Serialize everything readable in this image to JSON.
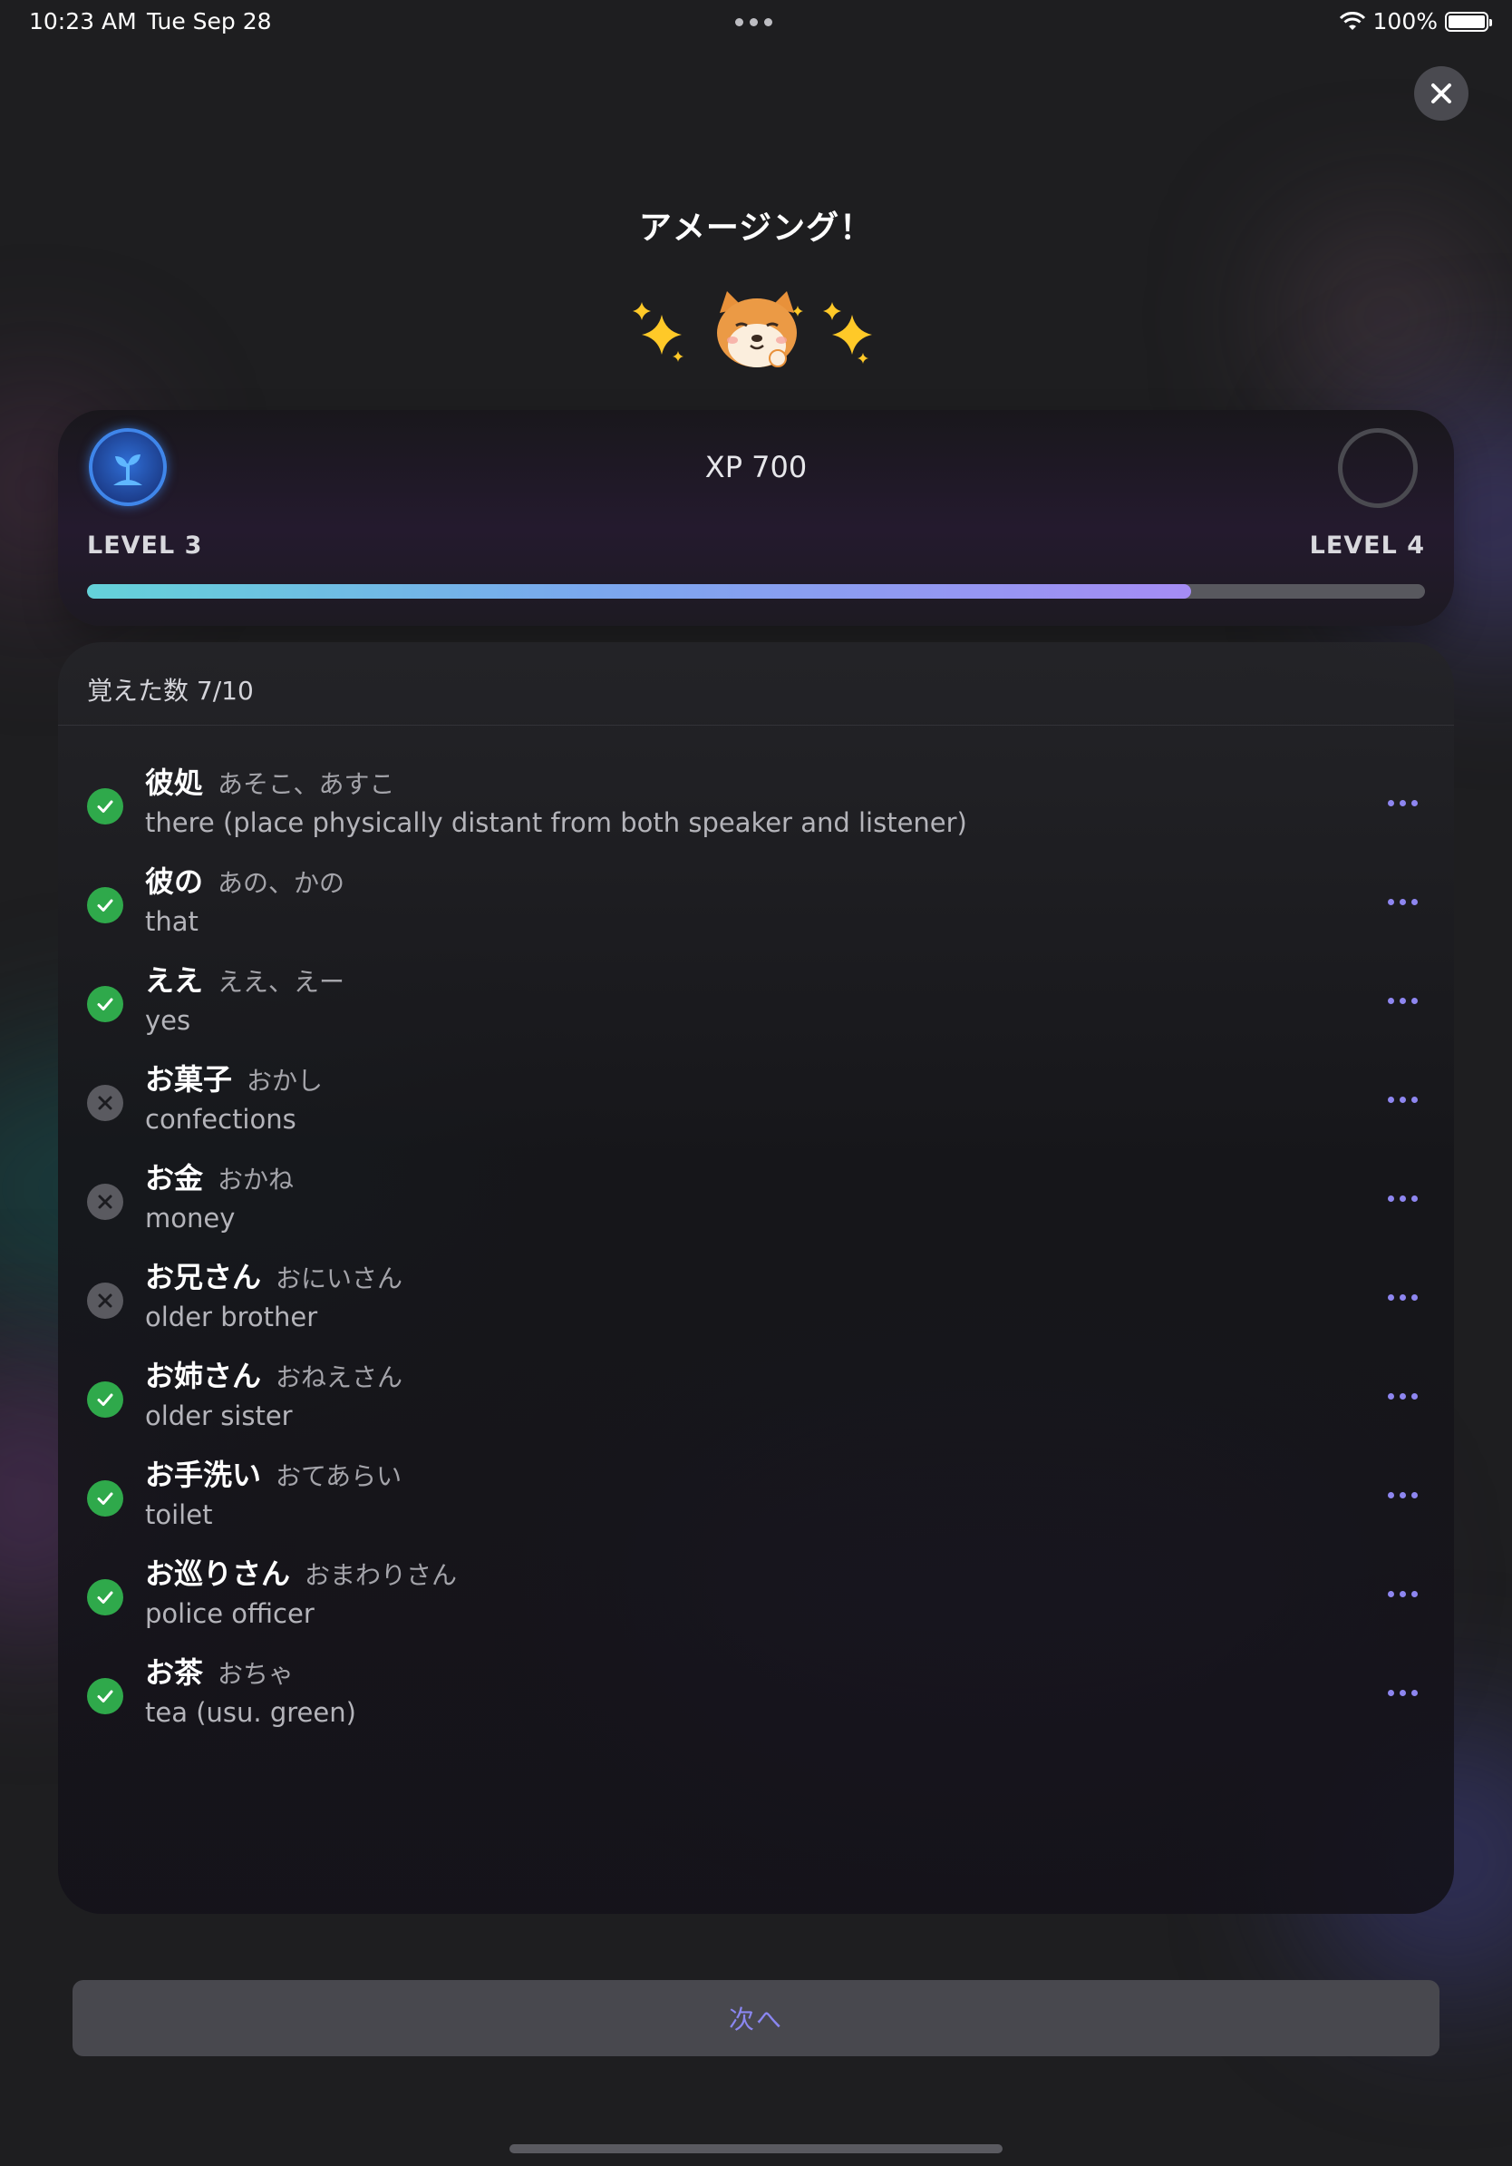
{
  "status_bar": {
    "time": "10:23 AM",
    "date": "Tue Sep 28",
    "battery": "100%"
  },
  "title": "アメージング！",
  "level": {
    "xp_label": "XP 700",
    "current_level": "LEVEL 3",
    "next_level": "LEVEL 4",
    "progress": 0.825
  },
  "words": {
    "header_label": "覚えた数",
    "header_count": "7/10",
    "items": [
      {
        "kanji": "彼処",
        "reading": "あそこ、あすこ",
        "meaning": "there (place physically distant from both speaker and listener)",
        "learned": true
      },
      {
        "kanji": "彼の",
        "reading": "あの、かの",
        "meaning": "that",
        "learned": true
      },
      {
        "kanji": "ええ",
        "reading": "ええ、えー",
        "meaning": "yes",
        "learned": true
      },
      {
        "kanji": "お菓子",
        "reading": "おかし",
        "meaning": "confections",
        "learned": false
      },
      {
        "kanji": "お金",
        "reading": "おかね",
        "meaning": "money",
        "learned": false
      },
      {
        "kanji": "お兄さん",
        "reading": "おにいさん",
        "meaning": "older brother",
        "learned": false
      },
      {
        "kanji": "お姉さん",
        "reading": "おねえさん",
        "meaning": "older sister",
        "learned": true
      },
      {
        "kanji": "お手洗い",
        "reading": "おてあらい",
        "meaning": "toilet",
        "learned": true
      },
      {
        "kanji": "お巡りさん",
        "reading": "おまわりさん",
        "meaning": "police officer",
        "learned": true
      },
      {
        "kanji": "お茶",
        "reading": "おちゃ",
        "meaning": "tea (usu. green)",
        "learned": true
      }
    ]
  },
  "next_button_label": "次へ",
  "colors": {
    "accent": "#8e86f0",
    "learned": "#2fa94b",
    "not_learned": "#5a5a60"
  }
}
